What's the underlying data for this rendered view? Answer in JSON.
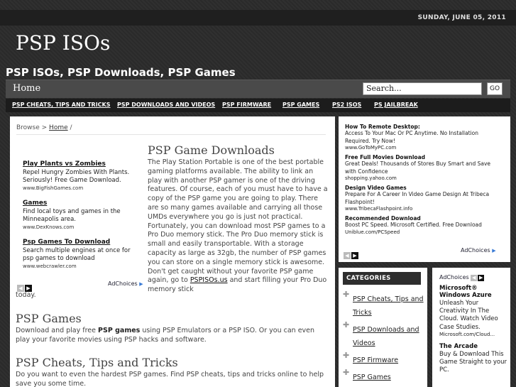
{
  "header": {
    "date": "SUNDAY, JUNE 05, 2011",
    "site_title": "PSP ISOs",
    "tagline": "PSP ISOs, PSP Downloads, PSP Games"
  },
  "nav": {
    "home": "Home",
    "search_value": "Search...",
    "search_button": "GO"
  },
  "categories_bar": [
    "PSP CHEATS, TIPS AND TRICKS",
    "PSP DOWNLOADS AND VIDEOS",
    "PSP FIRMWARE",
    "PSP GAMES",
    "PS2 ISOS",
    "PS JAILBREAK"
  ],
  "breadcrumb": {
    "prefix": "Browse >",
    "home": "Home",
    "sep": "/"
  },
  "left_ads": [
    {
      "title": "Play Plants vs Zombies",
      "desc": "Repel Hungry Zombies With Plants. Seriously! Free Game Download.",
      "url": "www.BigFishGames.com"
    },
    {
      "title": "Games",
      "desc": "Find local toys and games in the Minneapolis area.",
      "url": "www.DexKnows.com"
    },
    {
      "title": "Psp Games To Download",
      "desc": "Search multiple engines at once for psp games to download",
      "url": "www.webcrawler.com"
    }
  ],
  "adchoices": "AdChoices",
  "main": {
    "heading": "PSP Game Downloads",
    "intro": "The Play Station Portable is one of the best portable gaming platforms available. The ability to link an play with another PSP gamer is one of the driving features. Of course, each of you must have to have a copy of the PSP game you are going to play. There are so many games available and carrying all those UMDs everywhere you go is just not practical. Fortunately, you can download most PSP games to a Pro Duo memory stick. The Pro Duo memory stick is small and easily transportable. With a storage capacity as large as 32gb, the number of PSP games you can store on a single memory stick is awesome. Don't get caught without your favorite PSP game again, go to",
    "intro_link": "PSPISOs.us",
    "intro_after": "and start filling your Pro Duo memory stick",
    "intro_end": "today.",
    "sections": [
      {
        "heading": "PSP Games",
        "text_a": "Download and play free",
        "bold": "PSP games",
        "text_b": "using PSP Emulators or a PSP ISO. Or you can even play your favorite movies using PSP hacks and software."
      },
      {
        "heading": "PSP Cheats, Tips and Tricks",
        "text_a": "Do you want to even the hardest PSP games. Find PSP cheats, tips and tricks online to help save you some time.",
        "bold": "",
        "text_b": ""
      }
    ]
  },
  "right_ads": [
    {
      "title": "How To Remote Desktop:",
      "desc": "Access To Your Mac Or PC Anytime. No Installation Required. Try Now!",
      "url": "www.GoToMyPC.com"
    },
    {
      "title": "Free Full Movies Download",
      "desc": "Great Deals! Thousands of Stores Buy Smart and Save with Confidence",
      "url": "shopping.yahoo.com"
    },
    {
      "title": "Design Video Games",
      "desc": "Prepare For A Career In Video Game Design At Tribeca Flashpoint!",
      "url": "www.TribecaFlashpoint.info"
    },
    {
      "title": "Recommended Download",
      "desc": "Boost PC Speed. Microsoft Certified. Free Download",
      "url": "Uniblue.com/PCSpeed"
    }
  ],
  "sidebar_categories": {
    "header": "CATEGORIES",
    "items": [
      "PSP Cheats, Tips and Tricks",
      "PSP Downloads and Videos",
      "PSP Firmware",
      "PSP Games"
    ]
  },
  "sky_ads": [
    {
      "title": "Microsoft® Windows Azure",
      "desc": "Unleash Your Creativity In The Cloud. Watch Video Case Studies.",
      "url": "Microsoft.com/Cloud..."
    },
    {
      "title": "The Arcade",
      "desc": "Buy & Download This Game Straight to your PC.",
      "url": ""
    }
  ]
}
